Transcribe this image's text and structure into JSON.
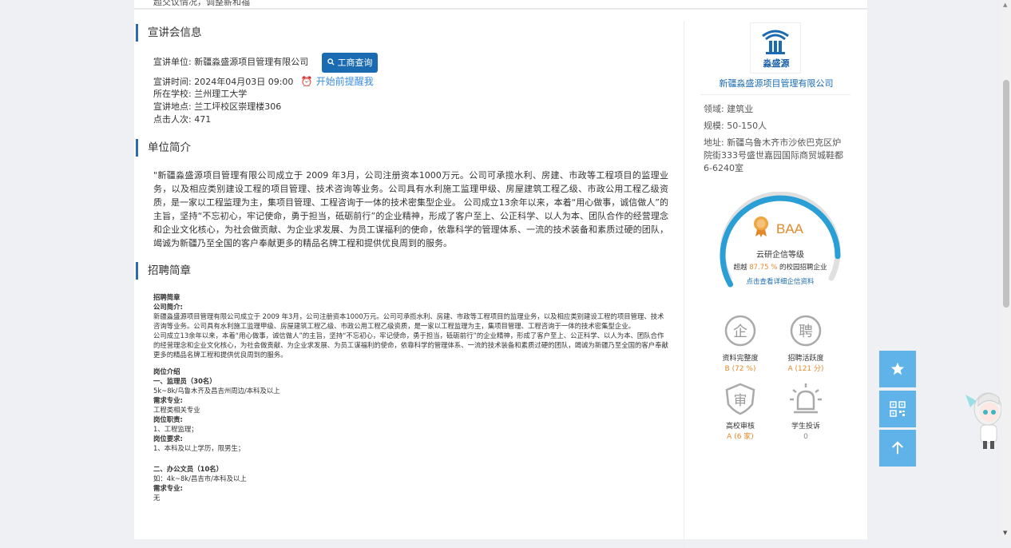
{
  "top_cut_text": "超交议情况，调整薪和福",
  "sections": {
    "info_title": "宣讲会信息",
    "intro_title": "单位简介",
    "brief_title": "招聘简章"
  },
  "session": {
    "unit_label": "宣讲单位:",
    "unit_value": "新疆淼盛源项目管理有限公司",
    "query_button": "工商查询",
    "time_label": "宣讲时间:",
    "time_value": "2024年04月03日 09:00",
    "remind_label": "开始前提醒我",
    "school_label": "所在学校:",
    "school_value": "兰州理工大学",
    "place_label": "宣讲地点:",
    "place_value": "兰工坪校区崇理楼306",
    "clicks_label": "点击人次:",
    "clicks_value": "471"
  },
  "intro_text": "\"新疆淼盛源项目管理有限公司成立于 2009 年3月，公司注册资本1000万元。公司可承揽水利、房建、市政等工程项目的监理业务，以及相应类别建设工程的项目管理、技术咨询等业务。公司具有水利施工监理甲级、房屋建筑工程乙级、市政公用工程乙级资质，是一家以工程监理为主，集项目管理、工程咨询于一体的技术密集型企业。 公司成立13余年以来，本着“用心做事，诚信做人”的主旨，坚持“不忘初心，牢记使命，勇于担当，砥砺前行”的企业精神，形成了客户至上、公正科学、以人为本、团队合作的经营理念和企业文化核心，为社会做贡献、为企业求发展、为员工谋福利的使命，依靠科学的管理体系、一流的技术装备和素质过硬的团队，竭诚为新疆乃至全国的客户奉献更多的精品名牌工程和提供优良周到的服务。",
  "brief": {
    "h1": "招聘简章",
    "h2": "公司简介:",
    "p1": "新疆淼盛源项目管理有限公司成立于 2009 年3月，公司注册资本1000万元。公司可承揽水利、房建、市政等工程项目的监理业务，以及相应类别建设工程的项目管理、技术咨询等业务。公司具有水利施工监理甲级、房屋建筑工程乙级、市政公用工程乙级资质，是一家以工程监理为主，集项目管理、工程咨询于一体的技术密集型企业。",
    "p2": "公司成立13余年以来，本着“用心做事，诚信做人”的主旨，坚持“不忘初心，牢记使命，勇于担当，砥砺前行”的企业精神，形成了客户至上、公正科学、以人为本、团队合作的经营理念和企业文化核心，为社会做贡献、为企业求发展、为员工谋福利的使命，依靠科学的管理体系、一流的技术装备和素质过硬的团队，竭诚为新疆乃至全国的客户奉献更多的精品名牌工程和提供优良周到的服务。",
    "h3": "岗位介绍",
    "job1_title": "一、监理员（30名）",
    "job1_salary": "5k~8k/乌鲁木齐及昌吉州周边/本科及以上",
    "req_major": "需求专业:",
    "job1_major": "工程类相关专业",
    "duty_label": "岗位职责:",
    "job1_duty": "1、工程监理；",
    "require_label": "岗位要求:",
    "job1_require": "1、本科及以上学历，限男生；",
    "job2_title": "二、办公文员（10名）",
    "job2_salary": "如：4k~8k/昌吉市/本科及以上",
    "job2_major_label": "需求专业:",
    "job2_major": "无"
  },
  "sidebar": {
    "logo_text": "淼盛源",
    "company_name": "新疆淼盛源项目管理有限公司",
    "field_label": "领域:",
    "field_value": "建筑业",
    "scale_label": "规模:",
    "scale_value": "50-150人",
    "addr_label": "地址:",
    "addr_value": "新疆乌鲁木齐市沙依巴克区炉院街333号盛世嘉园国际商贸城鞋都6-6240室",
    "grade": "BAA",
    "grade_title": "云研企信等级",
    "exceed_prefix": "超越",
    "exceed_value": "87.75 %",
    "exceed_suffix": "的校园招聘企业",
    "detail_link": "点击查看详细企信资料",
    "gauge_fraction": 0.8775,
    "metrics": [
      {
        "icon_char": "企",
        "label": "资料完整度",
        "value": "B (72 %)"
      },
      {
        "icon_char": "聘",
        "label": "招聘活跃度",
        "value": "A (121 分)"
      },
      {
        "icon_char": "审",
        "label": "高校审核",
        "value": "A (6 家)"
      },
      {
        "icon_char": "",
        "label": "学生投诉",
        "value": "0"
      }
    ]
  },
  "colors": {
    "accent": "#1a6bb1",
    "gauge_blue": "#2a9fd6",
    "orange": "#e08a2b",
    "float": "#5fb3e8"
  }
}
